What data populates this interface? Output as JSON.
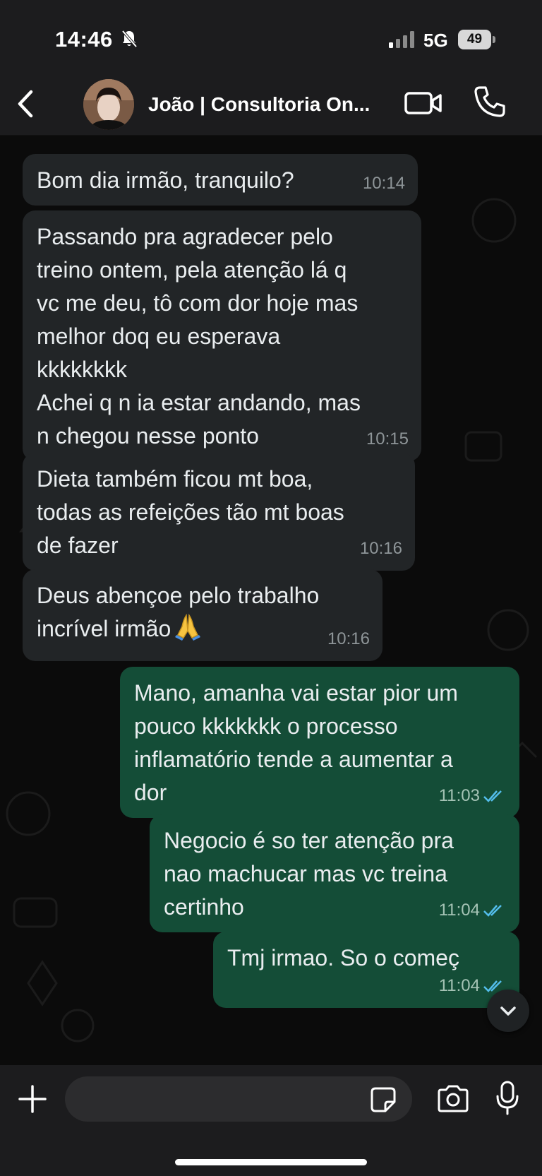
{
  "status_bar": {
    "time": "14:46",
    "network": "5G",
    "battery": "49",
    "icons": [
      "bell-slash-icon",
      "signal-icon",
      "battery-icon"
    ]
  },
  "header": {
    "contact_name": "João | Consultoria On...",
    "icons": [
      "back-chevron-icon",
      "video-call-icon",
      "phone-call-icon"
    ]
  },
  "messages": [
    {
      "direction": "in",
      "text": "Bom dia irmão, tranquilo?",
      "time": "10:14"
    },
    {
      "direction": "in",
      "text": "Passando pra agradecer pelo\ntreino ontem, pela atenção lá q\nvc me deu, tô com dor hoje mas\nmelhor doq eu esperava\nkkkkkkkk\nAchei q n ia estar andando, mas\nn chegou nesse ponto",
      "time": "10:15"
    },
    {
      "direction": "in",
      "text": "Dieta também ficou mt boa,\ntodas as refeições tão mt boas\nde fazer",
      "time": "10:16"
    },
    {
      "direction": "in",
      "text": "Deus abençoe pelo trabalho\nincrível irmão",
      "emoji": "praying-hands-icon",
      "time": "10:16"
    },
    {
      "direction": "out",
      "text": "Mano, amanha vai estar pior um\npouco kkkkkkk o processo\ninflamatório tende a aumentar a\ndor",
      "time": "11:03",
      "status": "read"
    },
    {
      "direction": "out",
      "text": "Negocio é so ter atenção pra\nnao machucar mas vc treina\ncertinho",
      "time": "11:04",
      "status": "read"
    },
    {
      "direction": "out",
      "text": "Tmj irmao. So o começ",
      "time": "11:04",
      "status": "read"
    }
  ],
  "input": {
    "placeholder": "",
    "icons": [
      "plus-icon",
      "sticker-icon",
      "camera-icon",
      "microphone-icon"
    ]
  },
  "colors": {
    "incoming_bubble": "#222527",
    "outgoing_bubble": "#144d37",
    "read_ticks": "#53bdeb",
    "background": "#0b0b0b"
  }
}
